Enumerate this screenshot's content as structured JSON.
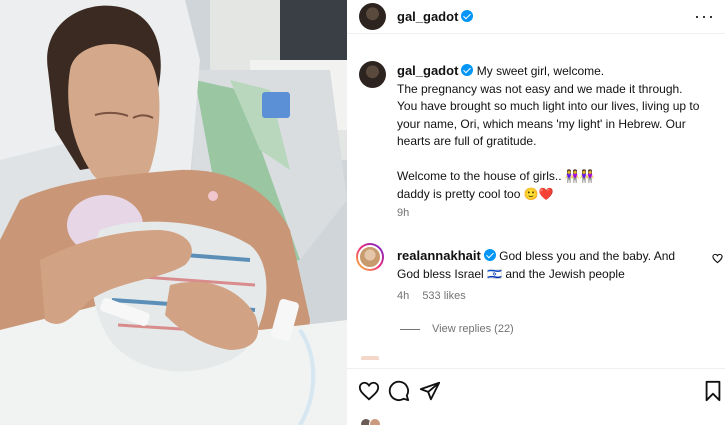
{
  "post": {
    "image_alt": "Photo of a mother holding her newborn baby in a hospital bed",
    "author": {
      "username": "gal_gadot",
      "verified": true
    },
    "caption": {
      "username": "gal_gadot",
      "lines": [
        "My sweet girl, welcome.",
        "The pregnancy was not easy and we made it through.",
        "You have brought so much light into our lives, living up to your name, Ori, which means 'my light' in Hebrew. Our hearts are full of gratitude.",
        "",
        "Welcome to the house of girls.. 👭👭",
        "daddy is pretty cool too 🙂❤️"
      ],
      "time": "9h"
    },
    "comments": [
      {
        "username": "realannakhait",
        "verified": true,
        "text": "God bless you and the baby. And God bless Israel 🇮🇱 and the Jewish people",
        "time": "4h",
        "likes": "533 likes",
        "view_replies": "View replies (22)"
      }
    ],
    "actions": [
      "heart-icon",
      "comment-icon",
      "share-icon",
      "bookmark-icon"
    ],
    "more_icon": "more-options-icon"
  }
}
